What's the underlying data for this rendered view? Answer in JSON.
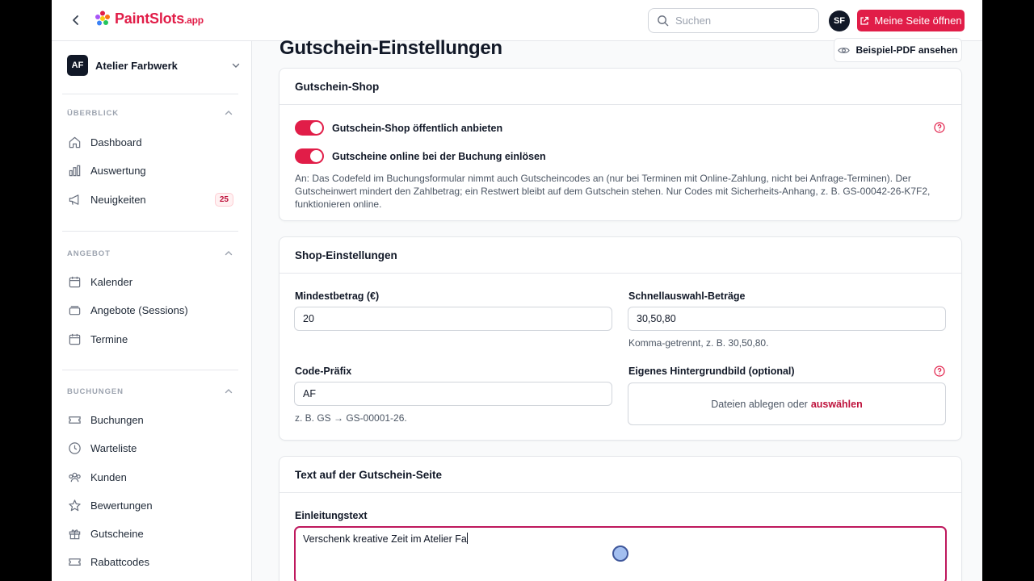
{
  "topbar": {
    "logo_text": "PaintSlots",
    "logo_suffix": ".app",
    "search_placeholder": "Suchen",
    "user_initials": "SF",
    "open_page_label": "Meine Seite öffnen"
  },
  "sidebar": {
    "org_initials": "AF",
    "org_name": "Atelier Farbwerk",
    "sections": [
      {
        "label": "ÜBERBLICK",
        "items": [
          {
            "label": "Dashboard",
            "icon": "home-icon"
          },
          {
            "label": "Auswertung",
            "icon": "bar-chart-icon"
          },
          {
            "label": "Neuigkeiten",
            "icon": "megaphone-icon",
            "badge": "25"
          }
        ]
      },
      {
        "label": "ANGEBOT",
        "items": [
          {
            "label": "Kalender",
            "icon": "calendar-icon"
          },
          {
            "label": "Angebote (Sessions)",
            "icon": "layers-icon"
          },
          {
            "label": "Termine",
            "icon": "calendar-icon"
          }
        ]
      },
      {
        "label": "BUCHUNGEN",
        "items": [
          {
            "label": "Buchungen",
            "icon": "ticket-icon"
          },
          {
            "label": "Warteliste",
            "icon": "clock-icon"
          },
          {
            "label": "Kunden",
            "icon": "users-icon"
          },
          {
            "label": "Bewertungen",
            "icon": "star-icon"
          },
          {
            "label": "Gutscheine",
            "icon": "gift-icon"
          },
          {
            "label": "Rabattcodes",
            "icon": "ticket-icon"
          }
        ]
      }
    ]
  },
  "main": {
    "title": "Gutschein-Einstellungen",
    "pdf_button": "Beispiel-PDF ansehen",
    "shop_card": {
      "title": "Gutschein-Shop",
      "toggle1_label": "Gutschein-Shop öffentlich anbieten",
      "toggle1_on": true,
      "toggle2_label": "Gutscheine online bei der Buchung einlösen",
      "toggle2_on": true,
      "hint": "An: Das Codefeld im Buchungsformular nimmt auch Gutscheincodes an (nur bei Terminen mit Online-Zahlung, nicht bei Anfrage-Terminen). Der Gutscheinwert mindert den Zahlbetrag; ein Restwert bleibt auf dem Gutschein stehen. Nur Codes mit Sicherheits-Anhang, z. B. GS-00042-26-K7F2, funktionieren online."
    },
    "settings_card": {
      "title": "Shop-Einstellungen",
      "min_amount_label": "Mindestbetrag (€)",
      "min_amount_value": "20",
      "quick_amounts_label": "Schnellauswahl-Beträge",
      "quick_amounts_value": "30,50,80",
      "quick_amounts_hint": "Komma-getrennt, z. B. 30,50,80.",
      "code_prefix_label": "Code-Präfix",
      "code_prefix_value": "AF",
      "code_prefix_hint": "z. B. GS → GS-00001-26.",
      "bg_image_label": "Eigenes Hintergrundbild (optional)",
      "dropzone_text": "Dateien ablegen oder",
      "dropzone_link": "auswählen"
    },
    "text_card": {
      "title": "Text auf der Gutschein-Seite",
      "intro_label": "Einleitungstext",
      "intro_value": "Verschenk kreative Zeit im Atelier Fa"
    }
  },
  "colors": {
    "accent": "#e11d48",
    "focus_border": "#be185d"
  }
}
